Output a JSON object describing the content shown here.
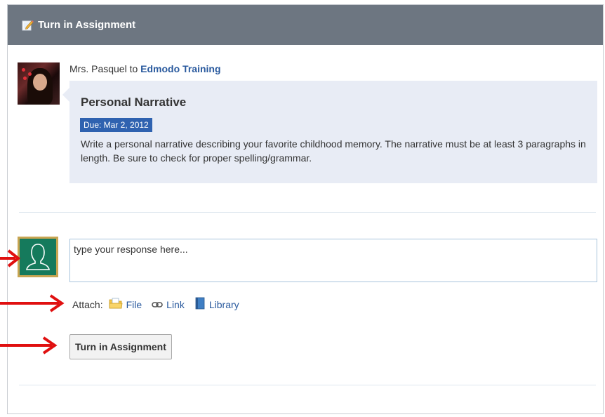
{
  "header": {
    "title": "Turn in Assignment",
    "icon": "edit-pencil-icon"
  },
  "post": {
    "author": "Mrs. Pasquel",
    "connector": "to",
    "group": "Edmodo Training"
  },
  "assignment": {
    "title": "Personal Narrative",
    "due": "Due: Mar 2, 2012",
    "description": "Write a personal narrative describing your favorite childhood memory. The narrative must be at least 3 paragraphs in length. Be sure to check for proper spelling/grammar."
  },
  "response": {
    "placeholder": "type your response here..."
  },
  "attach": {
    "label": "Attach:",
    "items": [
      {
        "label": "File",
        "icon": "folder-icon"
      },
      {
        "label": "Link",
        "icon": "chain-link-icon"
      },
      {
        "label": "Library",
        "icon": "book-icon"
      }
    ]
  },
  "submit": {
    "label": "Turn in Assignment"
  },
  "colors": {
    "header_bg": "#6d7681",
    "link": "#2a5a9e",
    "due_badge": "#2f62b0",
    "card_bg": "#e8ecf5",
    "arrow": "#e01010"
  }
}
